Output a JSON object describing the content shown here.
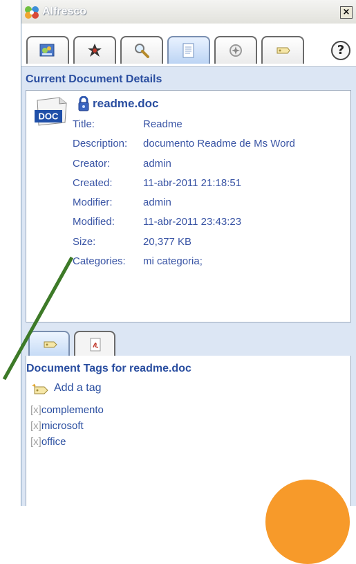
{
  "window": {
    "title": "Alfresco",
    "close_glyph": "×"
  },
  "toolbar": {
    "tabs": [
      {
        "name": "my-alfresco-icon",
        "active": false
      },
      {
        "name": "spaces-icon",
        "active": false
      },
      {
        "name": "search-icon",
        "active": false
      },
      {
        "name": "details-icon",
        "active": true
      },
      {
        "name": "ecm-icon",
        "active": false
      },
      {
        "name": "tag-icon",
        "active": false
      }
    ],
    "help_label": "?"
  },
  "details": {
    "heading": "Current Document Details",
    "doc_badge": "DOC",
    "doc_name": "readme.doc",
    "properties": [
      {
        "label": "Title:",
        "value": "Readme"
      },
      {
        "label": "Description:",
        "value": "documento Readme de Ms Word"
      },
      {
        "label": "Creator:",
        "value": "admin"
      },
      {
        "label": "Created:",
        "value": "11-abr-2011 21:18:51"
      },
      {
        "label": "Modifier:",
        "value": "admin"
      },
      {
        "label": "Modified:",
        "value": "11-abr-2011 23:43:23"
      },
      {
        "label": "Size:",
        "value": "20,377 KB"
      },
      {
        "label": "Categories:",
        "value": "mi categoria;"
      }
    ]
  },
  "subtabs": [
    {
      "name": "tags-tab-icon",
      "active": true
    },
    {
      "name": "pdf-tab-icon",
      "active": false
    }
  ],
  "tags": {
    "heading": "Document Tags for readme.doc",
    "add_label": "Add a tag",
    "remove_glyph": "[x]",
    "items": [
      "complemento",
      "microsoft",
      "office"
    ]
  },
  "colors": {
    "heading_blue": "#2a4ea0",
    "annotation_green": "#3d7a28",
    "annotation_orange": "#f79a2a"
  }
}
